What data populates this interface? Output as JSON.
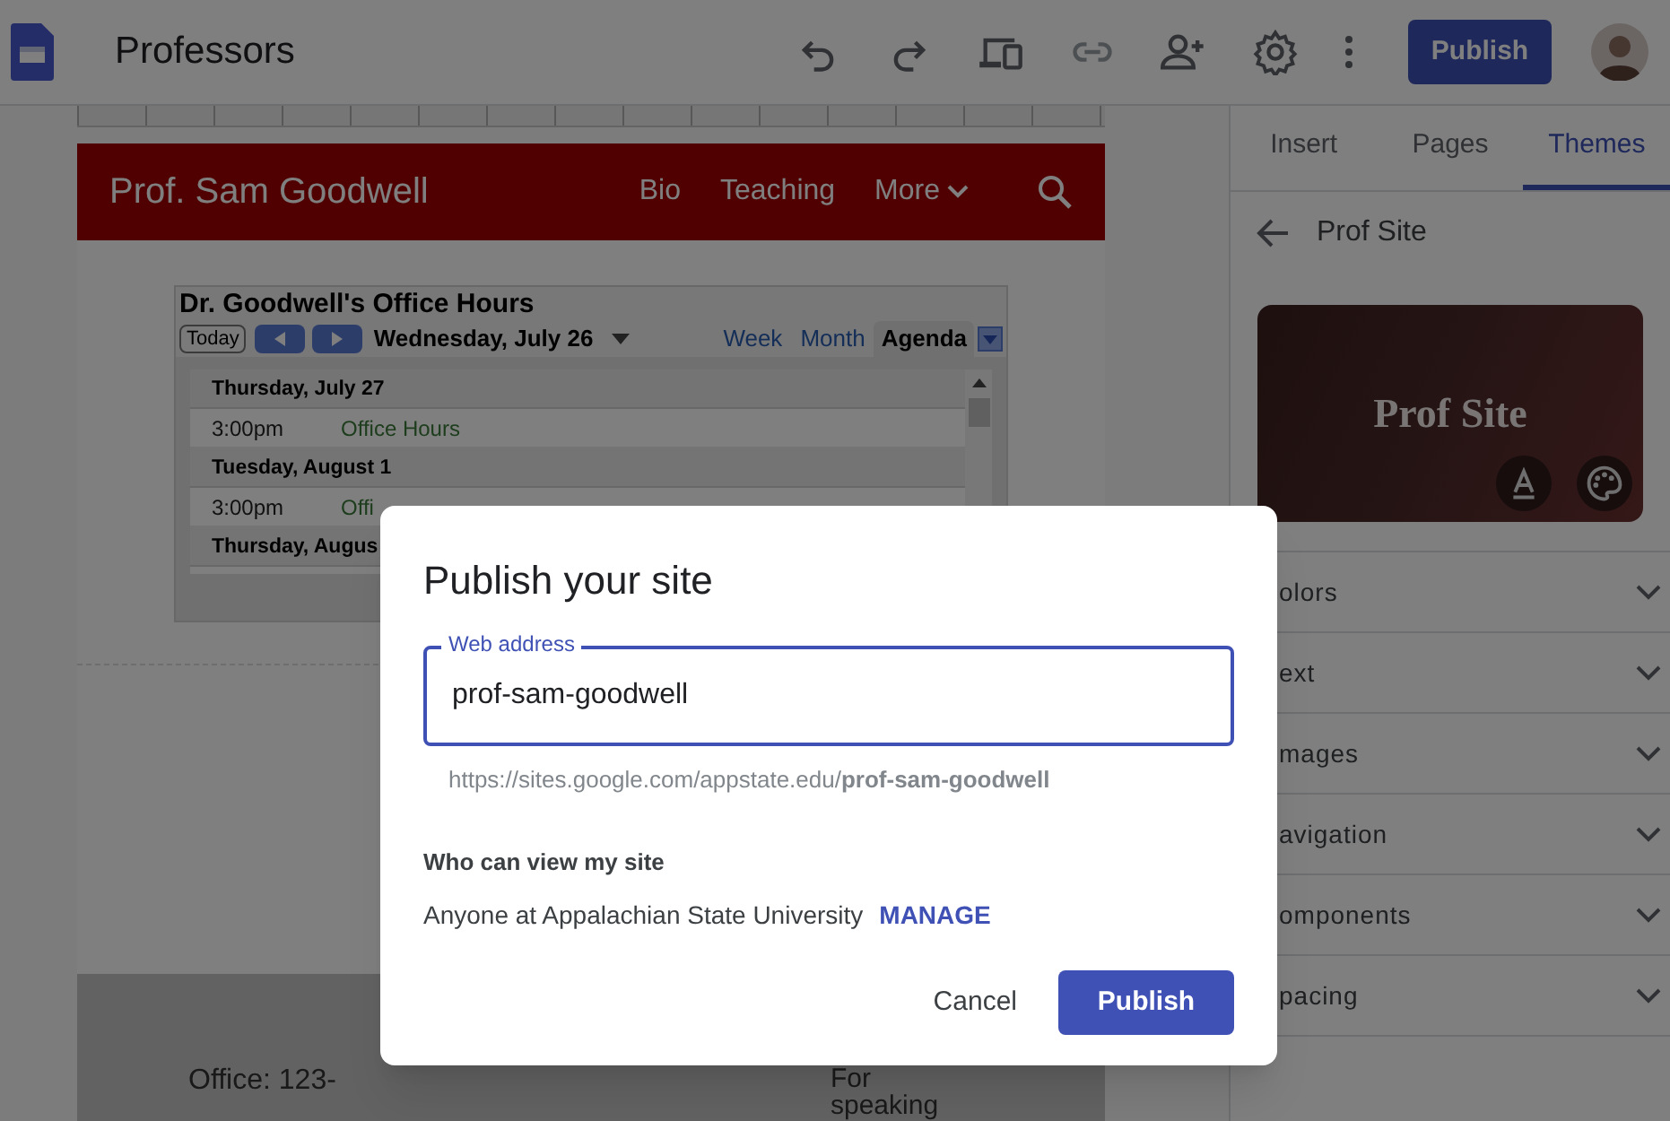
{
  "app_bar": {
    "title": "Professors",
    "publish_button": "Publish"
  },
  "site": {
    "title": "Prof. Sam Goodwell",
    "nav": [
      {
        "label": "Bio",
        "kind": "link"
      },
      {
        "label": "Teaching",
        "kind": "link"
      },
      {
        "label": "More",
        "kind": "menu"
      }
    ]
  },
  "calendar": {
    "title": "Dr. Goodwell's Office Hours",
    "today": "Today",
    "date": "Wednesday, July 26",
    "views": [
      {
        "label": "Week",
        "selected": false
      },
      {
        "label": "Month",
        "selected": false
      },
      {
        "label": "Agenda",
        "selected": true
      }
    ],
    "agenda": [
      {
        "kind": "day",
        "text": "Thursday, July 27"
      },
      {
        "kind": "event",
        "time": "3:00pm",
        "title": "Office Hours"
      },
      {
        "kind": "day",
        "text": "Tuesday, August 1"
      },
      {
        "kind": "event",
        "time": "3:00pm",
        "title": "Offi"
      },
      {
        "kind": "day",
        "text": "Thursday, Augus"
      }
    ]
  },
  "footer": {
    "column_1": "Office: 123-",
    "column_2": "For speaking"
  },
  "side_panel": {
    "tabs": [
      {
        "label": "Insert",
        "selected": false
      },
      {
        "label": "Pages",
        "selected": false
      },
      {
        "label": "Themes",
        "selected": true
      }
    ],
    "back_title": "Prof Site",
    "theme_card": {
      "title": "Prof Site"
    },
    "sections": [
      {
        "label": "olors"
      },
      {
        "label": "ext"
      },
      {
        "label": "mages"
      },
      {
        "label": "avigation"
      },
      {
        "label": "omponents"
      },
      {
        "label": "pacing"
      }
    ]
  },
  "dialog": {
    "title": "Publish your site",
    "field_label": "Web address",
    "value": "prof-sam-goodwell",
    "url": "https://sites.google.com/appstate.edu/**prof-sam-goodwell**",
    "who_heading": "Who can view my site",
    "audience": "Anyone at Appalachian State University",
    "manage": "MANAGE",
    "cancel": "Cancel",
    "publish": "Publish"
  }
}
